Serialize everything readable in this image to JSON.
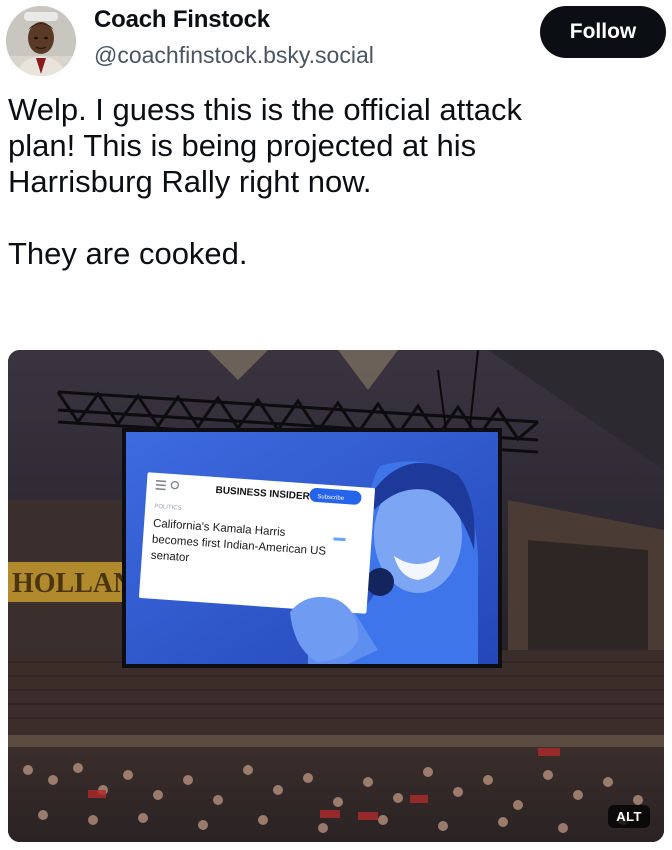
{
  "post": {
    "author": {
      "display_name": "Coach Finstock",
      "handle": "@coachfinstock.bsky.social",
      "avatar_icon": "person-avatar-icon"
    },
    "follow_label": "Follow",
    "text_lines": [
      "Welp. I guess this is the official attack",
      "plan! This is being projected at his",
      "Harrisburg Rally right now.",
      "They are cooked."
    ],
    "image": {
      "alt_badge": "ALT",
      "screen": {
        "publication": "BUSINESS INSIDER",
        "subscribe_label": "Subscribe",
        "section": "POLITICS",
        "headline_lines": [
          "California's Kamala Harris",
          "becomes first Indian-American US",
          "senator"
        ]
      },
      "arena_banner": "HOLLAN"
    }
  },
  "colors": {
    "follow_bg": "#0b0f14",
    "screen_blue": "#2f55c9",
    "text_primary": "#0b0f14",
    "text_secondary": "#4a5563"
  }
}
